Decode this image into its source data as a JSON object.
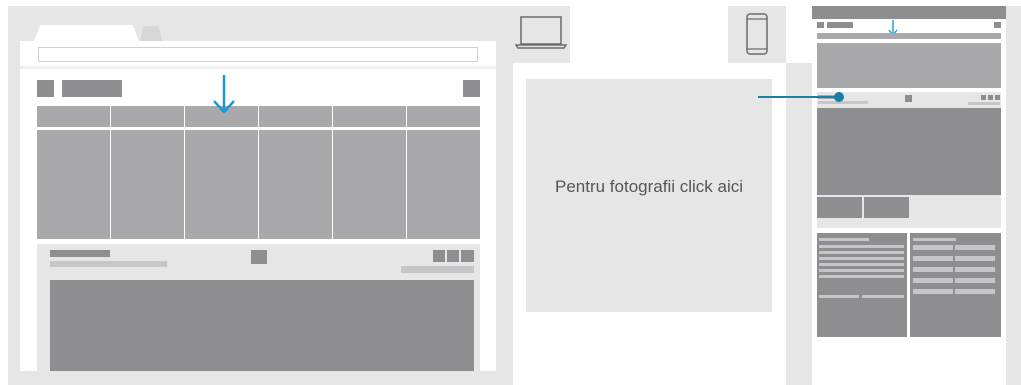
{
  "photo_panel": {
    "label": "Pentru fotografii click aici"
  },
  "colors": {
    "frame_gray": "#e6e6e7",
    "block_light": "#c6c6c8",
    "block_mid": "#a9a9ab",
    "block_dark": "#8e8e91",
    "arrow_blue": "#1a9ad6",
    "connector_teal": "#1a7fa6",
    "text_gray": "#55565a"
  },
  "icons": [
    "laptop-icon",
    "phone-icon",
    "down-arrow-icon",
    "connector-dot"
  ]
}
